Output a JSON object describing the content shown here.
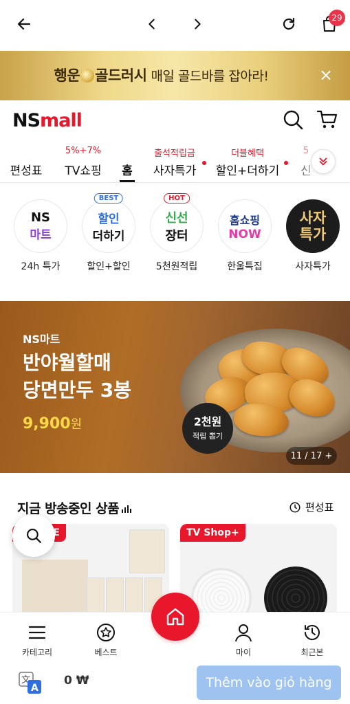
{
  "browser": {
    "cart_badge": "29",
    "icons": [
      "back-arrow-icon",
      "chevron-left-icon",
      "chevron-right-icon",
      "reload-icon",
      "shopping-bag-icon"
    ]
  },
  "promo": {
    "title_a": "행운",
    "title_b": "골드러시",
    "subtitle": "매일 골드바를 잡아라!",
    "close": "×"
  },
  "logo": {
    "ns": "NS",
    "mall": "mall"
  },
  "tabs": [
    {
      "label": "편성표",
      "hint": ""
    },
    {
      "label": "TV쇼핑",
      "hint": "5%+7%"
    },
    {
      "label": "홈",
      "hint": "",
      "active": true
    },
    {
      "label": "사자특가",
      "hint": "출석적립금",
      "dot": true
    },
    {
      "label": "할인+더하기",
      "hint": "더블혜택",
      "dot": true
    },
    {
      "label": "신",
      "hint": "5"
    }
  ],
  "shortcuts": [
    {
      "line1": "NS",
      "line2": "마트",
      "caption": "24h 특가"
    },
    {
      "line1": "할인",
      "line2": "더하기",
      "caption": "할인+할인",
      "tag": "BEST"
    },
    {
      "line1": "신선",
      "line2": "장터",
      "caption": "5천원적립",
      "tag": "HOT"
    },
    {
      "line1": "홈쇼핑",
      "line2": "NOW",
      "caption": "한울특집"
    },
    {
      "line1": "사자",
      "line2": "특가",
      "caption": "사자특가"
    }
  ],
  "hero": {
    "brand": "NS마트",
    "title_line1": "반야월할매",
    "title_line2": "당면만두 3봉",
    "price": "9,900",
    "price_unit": "원",
    "reward_a": "2천원",
    "reward_b": "적립 뽑기",
    "pager": "11 / 17 +"
  },
  "live": {
    "title": "지금 방송중인 상품",
    "schedule": "편성표",
    "cards": [
      {
        "tag": "TV LIVE"
      },
      {
        "tag": "TV Shop+"
      }
    ]
  },
  "bottom_nav": {
    "category": "카테고리",
    "best": "베스트",
    "my": "마이",
    "recent": "최근본"
  },
  "cart": {
    "total": "0 ₩",
    "add_button": "Thêm vào giỏ hàng"
  }
}
